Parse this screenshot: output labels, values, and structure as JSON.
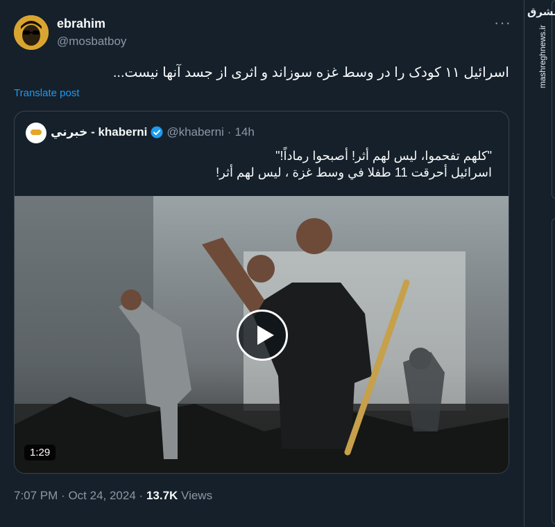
{
  "tweet": {
    "display_name": "ebrahim",
    "handle": "@mosbatboy",
    "more_icon": "more-dots-icon",
    "text": "اسرائیل ۱۱ کودک را در وسط غزه سوزاند و اثری از جسد آنها نیست...",
    "translate_label": "Translate post",
    "time": "7:07 PM",
    "separator": "·",
    "date": "Oct 24, 2024",
    "views_count": "13.7K",
    "views_label": "Views"
  },
  "quoted": {
    "name": "خبرني - khaberni",
    "handle": "@khaberni",
    "separator": "·",
    "time": "14h",
    "verified_icon": "verified-badge-icon",
    "text_line1": "\"كلهم تفحموا، ليس لهم أثر! أصبحوا رماداً!\"",
    "text_line2": "اسرائيل أحرقت 11 طفلا في وسط غزة ، ليس لهم أثر!",
    "video": {
      "duration": "1:29",
      "play_icon": "play-icon"
    }
  },
  "watermark": {
    "logo": "مشرق",
    "site": "mashreghnews.ir"
  },
  "colors": {
    "background": "#15202b",
    "text": "#f7f9f9",
    "muted": "#8b98a5",
    "accent": "#1d9bf0",
    "border": "#38444d"
  }
}
